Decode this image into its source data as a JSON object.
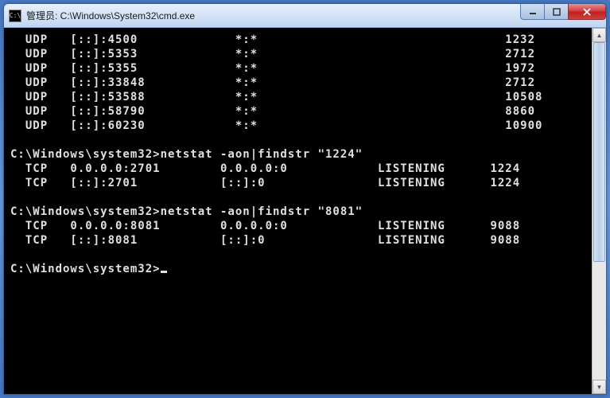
{
  "window": {
    "title": "管理员: C:\\Windows\\System32\\cmd.exe",
    "icon_label": "C:\\"
  },
  "terminal": {
    "udp_rows": [
      {
        "proto": "UDP",
        "local": "[::]:4500",
        "remote": "*:*",
        "pid": "1232"
      },
      {
        "proto": "UDP",
        "local": "[::]:5353",
        "remote": "*:*",
        "pid": "2712"
      },
      {
        "proto": "UDP",
        "local": "[::]:5355",
        "remote": "*:*",
        "pid": "1972"
      },
      {
        "proto": "UDP",
        "local": "[::]:33848",
        "remote": "*:*",
        "pid": "2712"
      },
      {
        "proto": "UDP",
        "local": "[::]:53588",
        "remote": "*:*",
        "pid": "10508"
      },
      {
        "proto": "UDP",
        "local": "[::]:58790",
        "remote": "*:*",
        "pid": "8860"
      },
      {
        "proto": "UDP",
        "local": "[::]:60230",
        "remote": "*:*",
        "pid": "10900"
      }
    ],
    "cmd1": {
      "prompt": "C:\\Windows\\system32>",
      "command": "netstat -aon|findstr \"1224\"",
      "rows": [
        {
          "proto": "TCP",
          "local": "0.0.0.0:2701",
          "remote": "0.0.0.0:0",
          "state": "LISTENING",
          "pid": "1224"
        },
        {
          "proto": "TCP",
          "local": "[::]:2701",
          "remote": "[::]:0",
          "state": "LISTENING",
          "pid": "1224"
        }
      ]
    },
    "cmd2": {
      "prompt": "C:\\Windows\\system32>",
      "command": "netstat -aon|findstr \"8081\"",
      "rows": [
        {
          "proto": "TCP",
          "local": "0.0.0.0:8081",
          "remote": "0.0.0.0:0",
          "state": "LISTENING",
          "pid": "9088"
        },
        {
          "proto": "TCP",
          "local": "[::]:8081",
          "remote": "[::]:0",
          "state": "LISTENING",
          "pid": "9088"
        }
      ]
    },
    "final_prompt": "C:\\Windows\\system32>"
  }
}
